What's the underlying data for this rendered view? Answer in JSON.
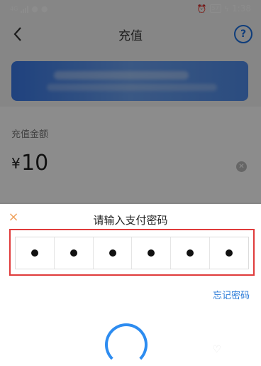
{
  "status_bar": {
    "network": "4G",
    "battery": "57",
    "time": "1:38"
  },
  "nav": {
    "title": "充值",
    "help": "?"
  },
  "recharge": {
    "amount_label": "充值金额",
    "currency": "¥",
    "amount": "10"
  },
  "payment_sheet": {
    "close": "×",
    "title": "请输入支付密码",
    "pin_digits_entered": 6,
    "pin_length": 6,
    "forgot_password": "忘记密码"
  },
  "colors": {
    "accent": "#1d6fe0",
    "highlight": "#e03b3b",
    "link": "#2b7bd8",
    "spinner": "#2d8cf0"
  },
  "icons": {
    "back": "chevron-left-icon",
    "help": "help-circle-icon",
    "clear": "clear-circle-icon",
    "close": "close-icon"
  }
}
